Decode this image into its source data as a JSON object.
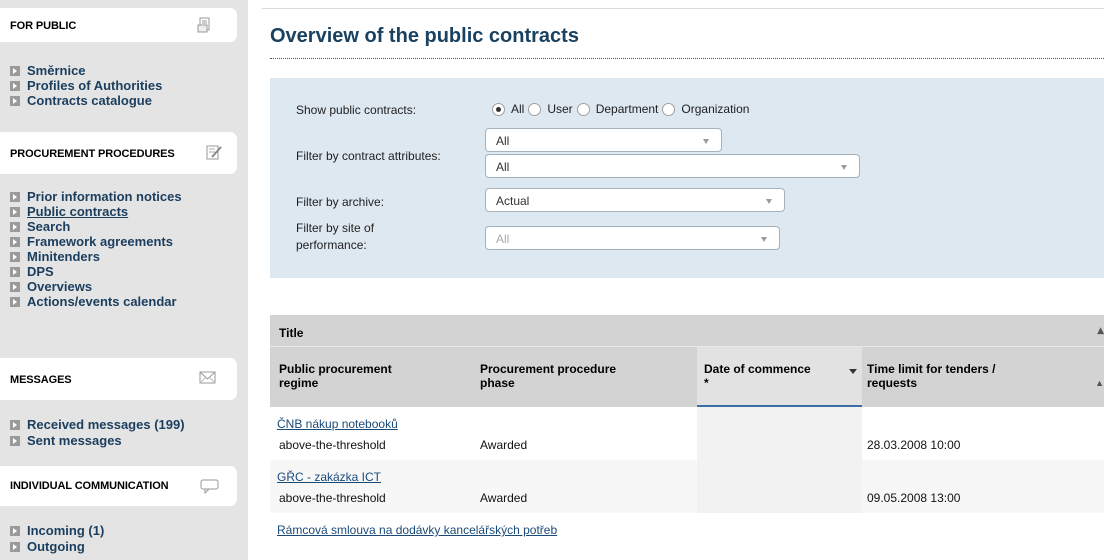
{
  "sidebar": {
    "sections": [
      {
        "title": "FOR PUBLIC",
        "icon": "document-icon",
        "items": [
          {
            "label": "Směrnice"
          },
          {
            "label": "Profiles of Authorities"
          },
          {
            "label": "Contracts catalogue"
          }
        ]
      },
      {
        "title": "PROCUREMENT PROCEDURES",
        "icon": "edit-icon",
        "items": [
          {
            "label": "Prior information notices"
          },
          {
            "label": "Public contracts"
          },
          {
            "label": "Search"
          },
          {
            "label": "Framework agreements"
          },
          {
            "label": "Minitenders"
          },
          {
            "label": "DPS"
          },
          {
            "label": "Overviews"
          },
          {
            "label": "Actions/events calendar"
          }
        ]
      },
      {
        "title": "MESSAGES",
        "icon": "envelope-icon",
        "items": [
          {
            "label": "Received messages (199)"
          },
          {
            "label": "Sent messages"
          }
        ]
      },
      {
        "title": "INDIVIDUAL COMMUNICATION",
        "icon": "speech-bubble-icon",
        "items": [
          {
            "label": "Incoming (1)"
          },
          {
            "label": "Outgoing"
          }
        ]
      }
    ]
  },
  "main": {
    "title": "Overview of the public contracts",
    "filters": {
      "show_label": "Show public contracts:",
      "radios": [
        {
          "label": "All",
          "selected": true
        },
        {
          "label": "User",
          "selected": false
        },
        {
          "label": "Department",
          "selected": false
        },
        {
          "label": "Organization",
          "selected": false
        }
      ],
      "attributes_label": "Filter by contract attributes:",
      "attributes_value_1": "All",
      "attributes_value_2": "All",
      "archive_label": "Filter by archive:",
      "archive_value": "Actual",
      "site_label_1": "Filter by site of",
      "site_label_2": "performance:",
      "site_value": "All"
    },
    "table": {
      "title_header": "Title",
      "columns": [
        {
          "line1": "Public procurement",
          "line2": "regime"
        },
        {
          "line1": "Procurement procedure",
          "line2": "phase"
        },
        {
          "line1": "Date of commence",
          "line2": "*"
        },
        {
          "line1": "Time limit for tenders /",
          "line2": "requests"
        }
      ],
      "rows": [
        {
          "title": "ČNB nákup notebooků",
          "regime": "above-the-threshold",
          "phase": "Awarded",
          "date": "",
          "limit": "28.03.2008 10:00"
        },
        {
          "title": "GŘC - zakázka ICT",
          "regime": "above-the-threshold",
          "phase": "Awarded",
          "date": "",
          "limit": "09.05.2008 13:00"
        },
        {
          "title": "Rámcová smlouva na dodávky kancelářských potřeb",
          "regime": "",
          "phase": "",
          "date": "",
          "limit": ""
        }
      ]
    }
  }
}
